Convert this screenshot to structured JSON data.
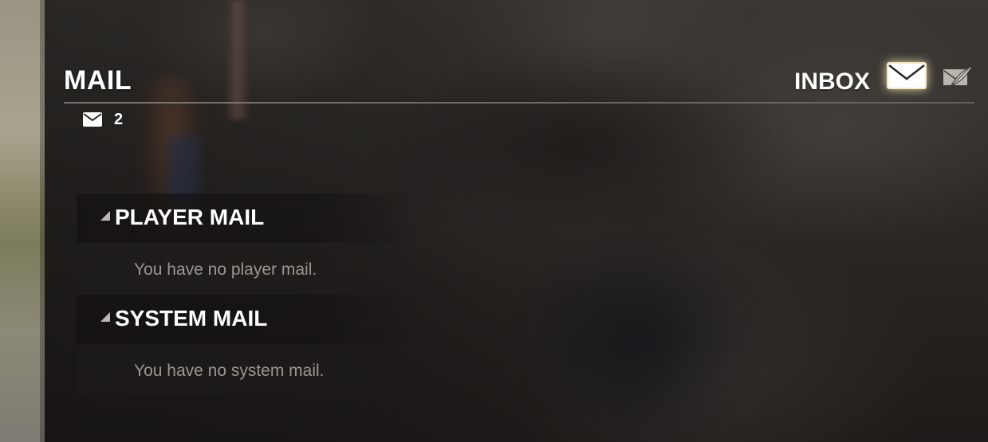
{
  "header": {
    "title": "MAIL",
    "unread_count": "2",
    "inbox_label": "INBOX",
    "tabs": [
      {
        "name": "inbox",
        "icon": "envelope-icon",
        "active": true
      },
      {
        "name": "compose",
        "icon": "quill-icon",
        "active": false
      }
    ]
  },
  "sections": [
    {
      "label": "PLAYER MAIL",
      "empty_text": "You have no player mail.",
      "expanded": true
    },
    {
      "label": "SYSTEM MAIL",
      "empty_text": "You have no system mail.",
      "expanded": true
    }
  ],
  "colors": {
    "text_primary": "#ffffff",
    "text_muted": "#9a9690",
    "active_glow": "#fff0be"
  }
}
